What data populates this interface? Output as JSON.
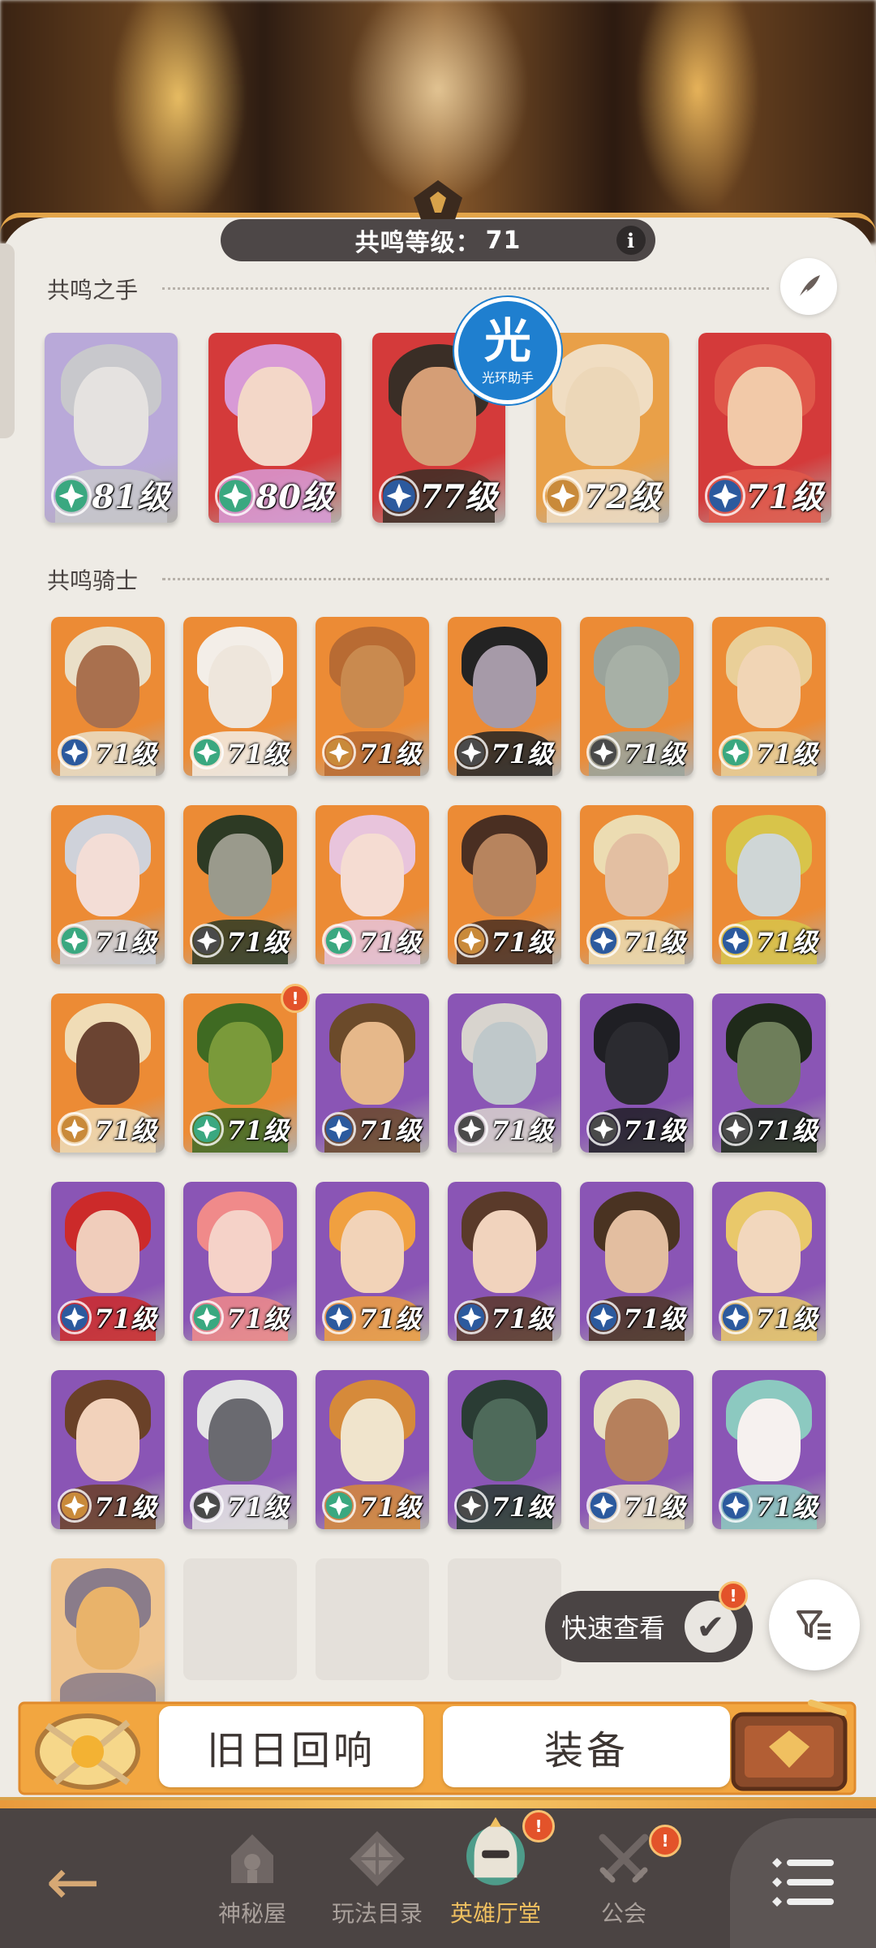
{
  "header": {
    "level_label": "共鸣等级：",
    "level_value": "71",
    "info_label": "i"
  },
  "sections": {
    "hands_title": "共鸣之手",
    "knights_title": "共鸣骑士"
  },
  "watermark": {
    "glyph": "光",
    "caption": "光环助手"
  },
  "hands": [
    {
      "level": "81级",
      "bg": "#b9a9d9",
      "hair": "#c8c8cc",
      "skin": "#e5e2e0",
      "badge": "#3aa880"
    },
    {
      "level": "80级",
      "bg": "#d43a3a",
      "hair": "#d89ad6",
      "skin": "#f3d7c8",
      "badge": "#3aa880"
    },
    {
      "level": "77级",
      "bg": "#d43a3a",
      "hair": "#3a2e26",
      "skin": "#d59e76",
      "badge": "#2c5a9e"
    },
    {
      "level": "72级",
      "bg": "#e9a048",
      "hair": "#f0ddc2",
      "skin": "#ecd7b8",
      "badge": "#c98a3a"
    },
    {
      "level": "71级",
      "bg": "#d43a3a",
      "hair": "#e0584a",
      "skin": "#f2c9a8",
      "badge": "#2c5a9e"
    }
  ],
  "knights": [
    {
      "level": "71级",
      "bg": "#ec8b35",
      "hair": "#eadfc8",
      "skin": "#a9704e",
      "badge": "#2c5a9e"
    },
    {
      "level": "71级",
      "bg": "#ec8b35",
      "hair": "#f3eee8",
      "skin": "#eee6dc",
      "badge": "#3aa880"
    },
    {
      "level": "71级",
      "bg": "#ec8b35",
      "hair": "#b86b33",
      "skin": "#c98a4f",
      "badge": "#c98a3a"
    },
    {
      "level": "71级",
      "bg": "#ec8b35",
      "hair": "#232323",
      "skin": "#a69aa8",
      "badge": "#4a4a4a"
    },
    {
      "level": "71级",
      "bg": "#ec8b35",
      "hair": "#9aa39b",
      "skin": "#a7b0a6",
      "badge": "#4a4a4a"
    },
    {
      "level": "71级",
      "bg": "#ec8b35",
      "hair": "#e9cf98",
      "skin": "#f1d5b5",
      "badge": "#3aa880"
    },
    {
      "level": "71级",
      "bg": "#ec8b35",
      "hair": "#cfd2da",
      "skin": "#f3ddd6",
      "badge": "#3aa880"
    },
    {
      "level": "71级",
      "bg": "#ec8b35",
      "hair": "#2d3a24",
      "skin": "#9a9a8c",
      "badge": "#4a4a4a"
    },
    {
      "level": "71级",
      "bg": "#ec8b35",
      "hair": "#e8c4dc",
      "skin": "#f5dcd2",
      "badge": "#3aa880"
    },
    {
      "level": "71级",
      "bg": "#ec8b35",
      "hair": "#4a2f22",
      "skin": "#b7845e",
      "badge": "#c98a3a"
    },
    {
      "level": "71级",
      "bg": "#ec8b35",
      "hair": "#ecdcb2",
      "skin": "#e3bfa2",
      "badge": "#2c5a9e"
    },
    {
      "level": "71级",
      "bg": "#ec8b35",
      "hair": "#d8c44a",
      "skin": "#cfd6d6",
      "badge": "#2c5a9e"
    },
    {
      "level": "71级",
      "bg": "#ec8b35",
      "hair": "#f0dcb6",
      "skin": "#6b4432",
      "badge": "#c98a3a"
    },
    {
      "level": "71级",
      "bg": "#ec8b35",
      "hair": "#3f6a22",
      "skin": "#7a9a3a",
      "badge": "#3aa880",
      "alert": true
    },
    {
      "level": "71级",
      "bg": "#8a55b5",
      "hair": "#6b4a2a",
      "skin": "#e6b88a",
      "badge": "#2c5a9e"
    },
    {
      "level": "71级",
      "bg": "#8a55b5",
      "hair": "#d8d4ce",
      "skin": "#bfc8ca",
      "badge": "#4a4a4a"
    },
    {
      "level": "71级",
      "bg": "#8a55b5",
      "hair": "#1f1f24",
      "skin": "#2b2b30",
      "badge": "#4a4a4a"
    },
    {
      "level": "71级",
      "bg": "#8a55b5",
      "hair": "#1f2a1a",
      "skin": "#6e7e5a",
      "badge": "#4a4a4a"
    },
    {
      "level": "71级",
      "bg": "#8a55b5",
      "hair": "#cc2a2a",
      "skin": "#f0cdbb",
      "badge": "#2c5a9e"
    },
    {
      "level": "71级",
      "bg": "#8a55b5",
      "hair": "#f08a8a",
      "skin": "#f5d2c8",
      "badge": "#3aa880"
    },
    {
      "level": "71级",
      "bg": "#8a55b5",
      "hair": "#f0a040",
      "skin": "#f2d3b8",
      "badge": "#2c5a9e"
    },
    {
      "level": "71级",
      "bg": "#8a55b5",
      "hair": "#5a3a2a",
      "skin": "#f1d3bd",
      "badge": "#2c5a9e"
    },
    {
      "level": "71级",
      "bg": "#8a55b5",
      "hair": "#4a3322",
      "skin": "#e3bea0",
      "badge": "#2c5a9e"
    },
    {
      "level": "71级",
      "bg": "#8a55b5",
      "hair": "#e9c86a",
      "skin": "#f2d7bd",
      "badge": "#2c5a9e"
    },
    {
      "level": "71级",
      "bg": "#8a55b5",
      "hair": "#6a4128",
      "skin": "#f2d2bb",
      "badge": "#c98a3a"
    },
    {
      "level": "71级",
      "bg": "#8a55b5",
      "hair": "#e5e5e5",
      "skin": "#6a6a70",
      "badge": "#4a4a4a"
    },
    {
      "level": "71级",
      "bg": "#8a55b5",
      "hair": "#d68a3a",
      "skin": "#f0e4cc",
      "badge": "#3aa880"
    },
    {
      "level": "71级",
      "bg": "#8a55b5",
      "hair": "#2a3c34",
      "skin": "#4e6a5a",
      "badge": "#4a4a4a"
    },
    {
      "level": "71级",
      "bg": "#8a55b5",
      "hair": "#e8dfc2",
      "skin": "#b6805c",
      "badge": "#2c5a9e"
    },
    {
      "level": "71级",
      "bg": "#8a55b5",
      "hair": "#8cc9c0",
      "skin": "#f6f1ef",
      "badge": "#2c5a9e"
    },
    {
      "level": "",
      "bg": "#efc48f",
      "hair": "#8a7c8a",
      "skin": "#e9b36a",
      "badge": ""
    }
  ],
  "quick_view": {
    "label": "快速查看",
    "check": "✔",
    "alert": "!"
  },
  "banners": {
    "echo": "旧日回响",
    "equip": "装备"
  },
  "nav": {
    "back": "←",
    "items": [
      {
        "label": "神秘屋",
        "active": false
      },
      {
        "label": "玩法目录",
        "active": false
      },
      {
        "label": "英雄厅堂",
        "active": true,
        "alert": "!"
      },
      {
        "label": "公会",
        "active": false,
        "alert": "!"
      }
    ]
  },
  "colors": {
    "accent": "#e3a54a",
    "dark_panel": "#4d4747",
    "alert": "#e3532a",
    "active_nav": "#f0c060"
  }
}
